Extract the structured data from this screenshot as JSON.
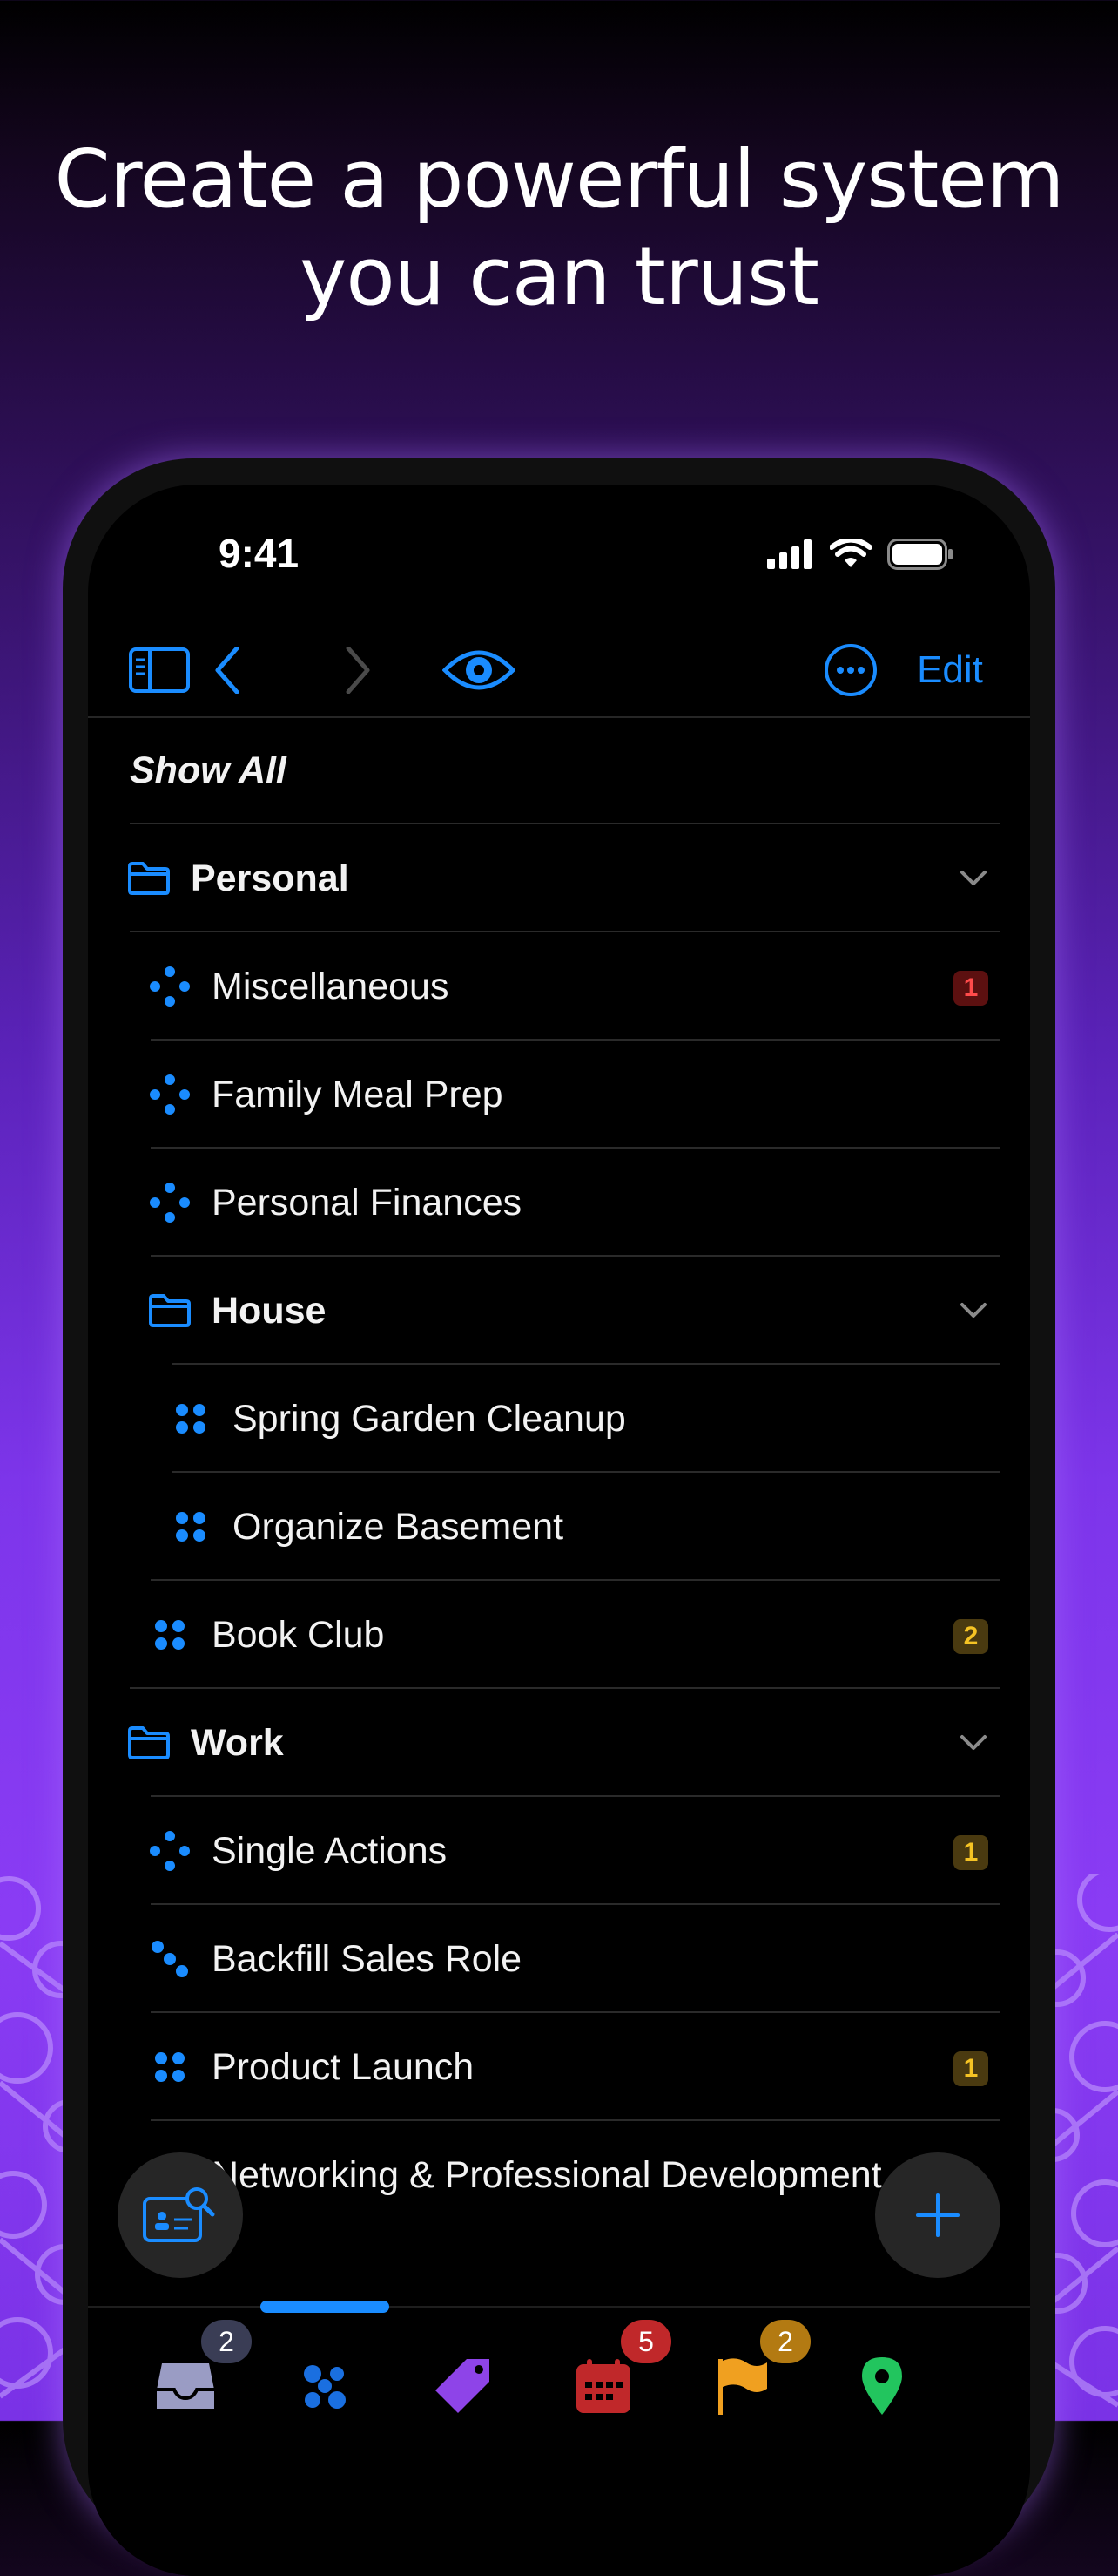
{
  "headline": {
    "line1": "Create a powerful system",
    "line2": "you can trust"
  },
  "status_bar": {
    "time": "9:41"
  },
  "toolbar": {
    "edit_label": "Edit"
  },
  "accent_color": "#1a8cff",
  "list": {
    "show_all": "Show All",
    "rows": [
      {
        "label": "Personal",
        "kind": "folder",
        "icon": "folder-icon",
        "expanded": true
      },
      {
        "label": "Miscellaneous",
        "kind": "project",
        "icon": "single-actions-icon",
        "badge": "1",
        "badge_color": "red"
      },
      {
        "label": "Family Meal Prep",
        "kind": "project",
        "icon": "single-actions-icon"
      },
      {
        "label": "Personal Finances",
        "kind": "project",
        "icon": "single-actions-icon"
      },
      {
        "label": "House",
        "kind": "folder",
        "icon": "folder-icon",
        "expanded": true
      },
      {
        "label": "Spring Garden Cleanup",
        "kind": "project",
        "icon": "parallel-project-icon"
      },
      {
        "label": "Organize Basement",
        "kind": "project",
        "icon": "parallel-project-icon"
      },
      {
        "label": "Book Club",
        "kind": "project",
        "icon": "parallel-project-icon",
        "badge": "2",
        "badge_color": "amber"
      },
      {
        "label": "Work",
        "kind": "folder",
        "icon": "folder-icon",
        "expanded": true
      },
      {
        "label": "Single Actions",
        "kind": "project",
        "icon": "single-actions-icon",
        "badge": "1",
        "badge_color": "amber"
      },
      {
        "label": "Backfill Sales Role",
        "kind": "project",
        "icon": "sequential-project-icon"
      },
      {
        "label": "Product Launch",
        "kind": "project",
        "icon": "parallel-project-icon",
        "badge": "1",
        "badge_color": "amber"
      },
      {
        "label": "Networking & Professional Development",
        "kind": "project",
        "icon": "parallel-project-icon"
      }
    ]
  },
  "tab_bar": {
    "tabs": [
      {
        "name": "inbox",
        "icon": "inbox-icon",
        "badge": "2",
        "selected": false
      },
      {
        "name": "projects",
        "icon": "projects-icon",
        "selected": true
      },
      {
        "name": "tags",
        "icon": "tag-icon",
        "selected": false
      },
      {
        "name": "forecast",
        "icon": "calendar-icon",
        "badge": "5",
        "selected": false
      },
      {
        "name": "flagged",
        "icon": "flag-icon",
        "badge": "2",
        "selected": false
      },
      {
        "name": "nearby",
        "icon": "location-pin-icon",
        "selected": false
      }
    ]
  }
}
